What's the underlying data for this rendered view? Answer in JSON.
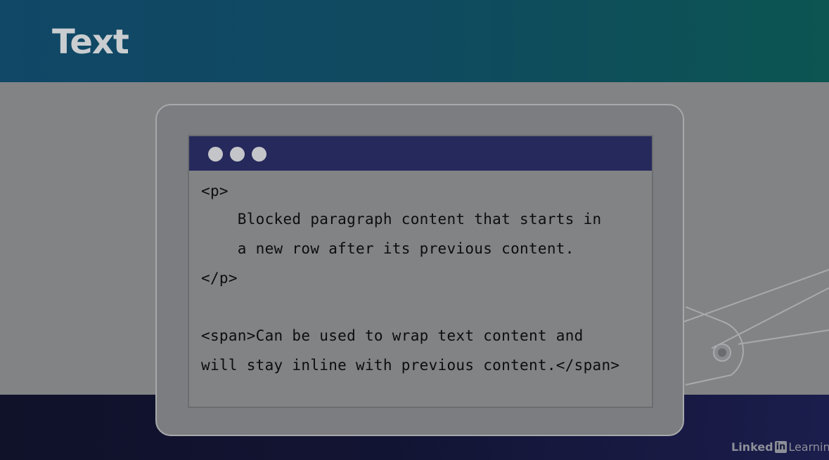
{
  "slide": {
    "title": "Text"
  },
  "window": {
    "controls": [
      "dot",
      "dot",
      "dot"
    ]
  },
  "code": {
    "lines": [
      "<p>",
      "    Blocked paragraph content that starts in",
      "    a new row after its previous content.",
      "</p>",
      "",
      "<span>Can be used to wrap text content and",
      "will stay inline with previous content.</span>"
    ]
  },
  "branding": {
    "logo_linked": "Linked",
    "logo_in": "in",
    "logo_learning": "Learning"
  },
  "colors": {
    "header": "#114767",
    "titlebar": "#25295b",
    "footer": "#121433",
    "panel": "#828385"
  },
  "icons": [
    "robot-arm-illustration",
    "window-control-dots"
  ]
}
